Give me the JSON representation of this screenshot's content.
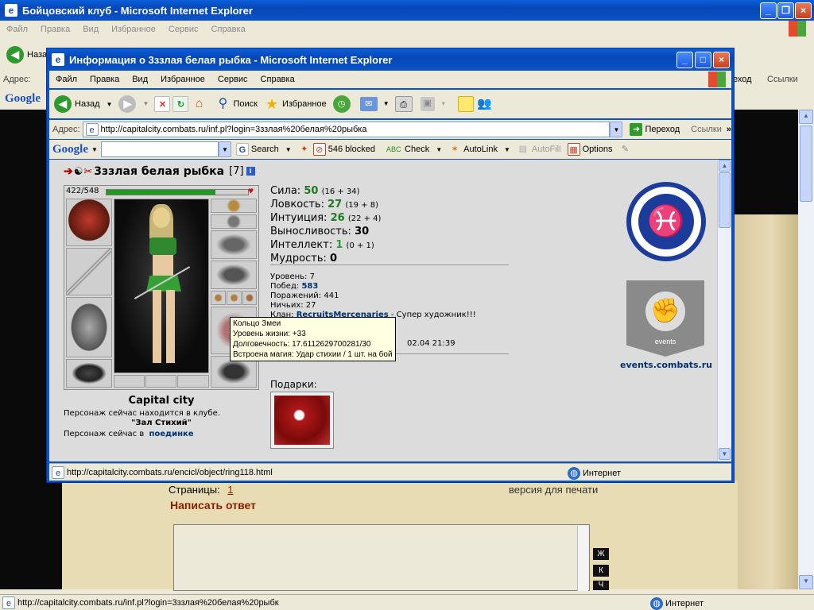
{
  "back_window": {
    "title": "Бойцовский клуб - Microsoft Internet Explorer",
    "menu": [
      "Файл",
      "Правка",
      "Вид",
      "Избранное",
      "Сервис",
      "Справка"
    ],
    "back_label": "Наза",
    "address_label": "Адрес:",
    "go_label": "еход",
    "links_label": "Ссылки",
    "google_label": "Google",
    "pages_label": "Страницы:",
    "page_number": "1",
    "print_label": "версия для печати",
    "reply_title": "Написать ответ",
    "format_buttons": [
      "Ж",
      "К",
      "Ч"
    ],
    "status_url": "http://capitalcity.combats.ru/inf.pl?login=3ззлая%20белая%20рыбк",
    "status_zone": "Интернет"
  },
  "popup": {
    "title": "Информация о 3ззлая белая рыбка - Microsoft Internet Explorer",
    "menu": [
      "Файл",
      "Правка",
      "Вид",
      "Избранное",
      "Сервис",
      "Справка"
    ],
    "toolbar": {
      "back": "Назад",
      "search": "Поиск",
      "favorites": "Избранное"
    },
    "address_label": "Адрес:",
    "url": "http://capitalcity.combats.ru/inf.pl?login=3ззлая%20белая%20рыбка",
    "go_label": "Переход",
    "links_label": "Ссылки",
    "google": {
      "logo": "Google",
      "search": "Search",
      "blocked": "546 blocked",
      "check": "Check",
      "autolink": "AutoLink",
      "autofill": "AutoFill",
      "options": "Options"
    },
    "status_url": "http://capitalcity.combats.ru/encicl/object/ring118.html",
    "status_zone": "Интернет"
  },
  "character": {
    "name": "3ззлая белая рыбка",
    "level_tag": "[7]",
    "hp": "422/548",
    "hp_fraction": 0.77,
    "city": "Capital city",
    "location_line1": "Персонаж сейчас находится в клубе.",
    "location_room": "\"Зал Стихий\"",
    "fight_prefix": "Персонаж сейчас в",
    "fight_link": "поединке",
    "stats": [
      {
        "label": "Сила:",
        "value": "50",
        "extra": "(16 + 34)"
      },
      {
        "label": "Ловкость:",
        "value": "27",
        "extra": "(19 + 8)"
      },
      {
        "label": "Интуиция:",
        "value": "26",
        "extra": "(22 + 4)"
      },
      {
        "label": "Выносливость:",
        "value": "30",
        "extra": ""
      },
      {
        "label": "Интеллект:",
        "value": "1",
        "extra": "(0 + 1)"
      },
      {
        "label": "Мудрость:",
        "value": "0",
        "extra": ""
      }
    ],
    "level_label": "Уровень: 7",
    "wins_label": "Побед:",
    "wins": "583",
    "losses_label": "Поражений: 441",
    "draws_label": "Ничьих: 27",
    "clan_label": "Клан:",
    "clan_name": "RecruitsMercenaries",
    "clan_title": "- Супер художник!!!",
    "reg_date_partial": "02.04 21:39",
    "gifts_label": "Подарки:",
    "events_link": "events.combats.ru",
    "events_emblem_text": "events"
  },
  "tooltip": {
    "name": "Кольцо Змеи",
    "hp": "Уровень жизни: +33",
    "durability": "Долговечность: 17.6112629700281/30",
    "magic": "Встроена магия: Удар стихии / 1 шт. на бой"
  },
  "colors": {
    "xp_blue": "#0a54c8",
    "hp_green": "#1f9a1f",
    "link_blue": "#00336e",
    "emblem_blue": "#1c3c9c",
    "stat_green": "#1e7a1e"
  }
}
